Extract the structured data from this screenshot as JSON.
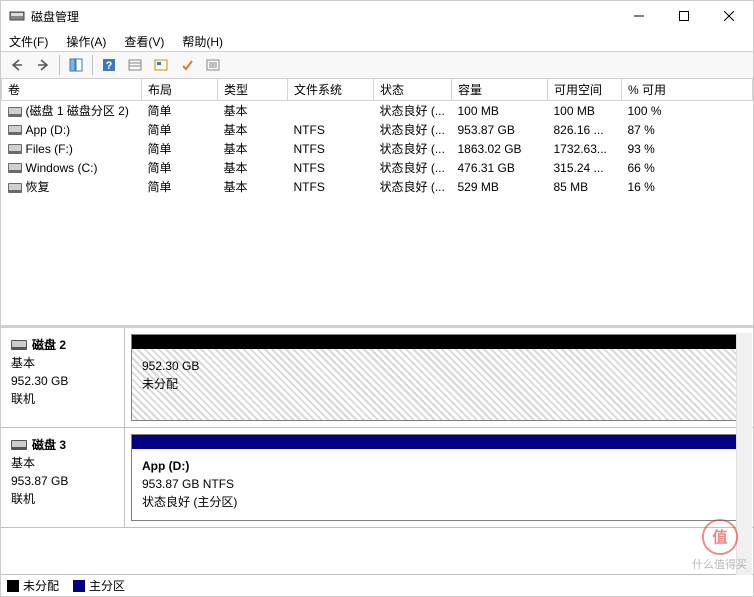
{
  "window": {
    "title": "磁盘管理",
    "menu": [
      "文件(F)",
      "操作(A)",
      "查看(V)",
      "帮助(H)"
    ]
  },
  "columns": {
    "volume": "卷",
    "layout": "布局",
    "type": "类型",
    "filesystem": "文件系统",
    "status": "状态",
    "capacity": "容量",
    "free": "可用空间",
    "pct": "% 可用"
  },
  "volumes": [
    {
      "name": "(磁盘 1 磁盘分区 2)",
      "layout": "简单",
      "type": "基本",
      "fs": "",
      "status": "状态良好 (...",
      "capacity": "100 MB",
      "free": "100 MB",
      "pct": "100 %"
    },
    {
      "name": "App (D:)",
      "layout": "简单",
      "type": "基本",
      "fs": "NTFS",
      "status": "状态良好 (...",
      "capacity": "953.87 GB",
      "free": "826.16 ...",
      "pct": "87 %"
    },
    {
      "name": "Files (F:)",
      "layout": "简单",
      "type": "基本",
      "fs": "NTFS",
      "status": "状态良好 (...",
      "capacity": "1863.02 GB",
      "free": "1732.63...",
      "pct": "93 %"
    },
    {
      "name": "Windows (C:)",
      "layout": "简单",
      "type": "基本",
      "fs": "NTFS",
      "status": "状态良好 (...",
      "capacity": "476.31 GB",
      "free": "315.24 ...",
      "pct": "66 %"
    },
    {
      "name": "恢复",
      "layout": "简单",
      "type": "基本",
      "fs": "NTFS",
      "status": "状态良好 (...",
      "capacity": "529 MB",
      "free": "85 MB",
      "pct": "16 %"
    }
  ],
  "disks": [
    {
      "name": "磁盘 2",
      "type": "基本",
      "size": "952.30 GB",
      "status": "联机",
      "parts": [
        {
          "title": "",
          "size": "952.30 GB",
          "state": "未分配",
          "kind": "unalloc"
        }
      ]
    },
    {
      "name": "磁盘 3",
      "type": "基本",
      "size": "953.87 GB",
      "status": "联机",
      "parts": [
        {
          "title": "App  (D:)",
          "size": "953.87 GB NTFS",
          "state": "状态良好 (主分区)",
          "kind": "primary"
        }
      ]
    }
  ],
  "legend": {
    "unalloc": "未分配",
    "primary": "主分区"
  },
  "watermark": "什么值得买"
}
